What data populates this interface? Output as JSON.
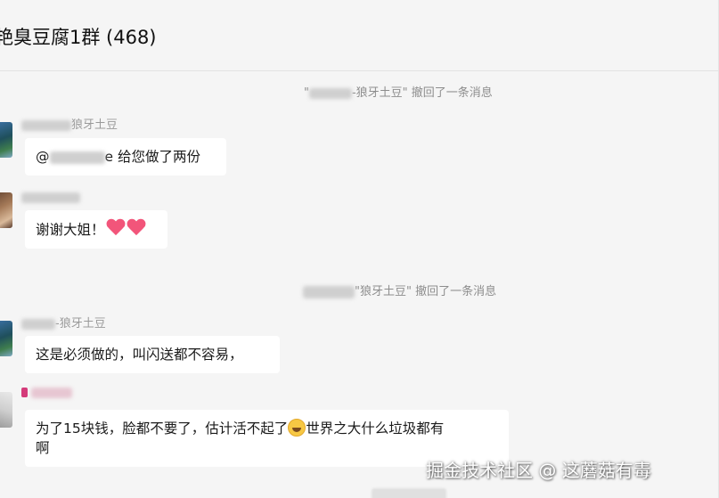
{
  "header": {
    "title": "艳臭豆腐1群 (468)"
  },
  "messages": [
    {
      "kind": "system",
      "prefix": "\"",
      "redacted_name": " ",
      "name_tail": "-狼牙土豆\"",
      "action": " 撤回了一条消息"
    },
    {
      "kind": "chat",
      "nick_tail": "狼牙土豆",
      "text_prefix": "@",
      "text": "e 给您做了两份"
    },
    {
      "kind": "chat",
      "nick_tail": "",
      "text": "谢谢大姐！"
    },
    {
      "kind": "system",
      "prefix": "",
      "redacted_name": " ",
      "name_tail": "\"狼牙土豆\"",
      "action": " 撤回了一条消息"
    },
    {
      "kind": "chat",
      "nick_tail": "-狼牙土豆",
      "text": "这是必须做的，叫闪送都不容易，"
    },
    {
      "kind": "chat",
      "nick_tail": "",
      "text_before": "为了15块钱，脸都不要了，估计活不起了",
      "text_after": "世界之大什么垃圾都有",
      "text_wrap": "啊"
    }
  ],
  "watermark": "掘金技术社区 @ 这蘑菇有毒",
  "icons": {
    "heart": "red-heart-icon",
    "emoji": "grinning-sweat-emoji-icon"
  },
  "colors": {
    "background": "#f5f5f5",
    "bubble": "#ffffff",
    "system_text": "#8d8d8d",
    "heart": "#f2557a"
  }
}
